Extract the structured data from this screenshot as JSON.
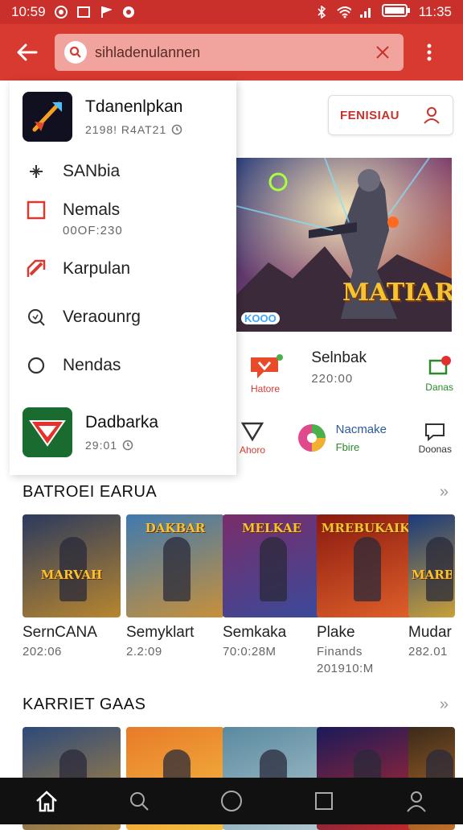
{
  "status_bar": {
    "time_left": "10:59",
    "time_right": "11:35"
  },
  "search": {
    "value": "sihladenulannen",
    "placeholder": ""
  },
  "account": {
    "label": "FENISIAU"
  },
  "drawer": {
    "header": {
      "title": "Tdanenlpkan",
      "subtitle": "2198! R4AT21"
    },
    "items": [
      {
        "label": "SANbia",
        "sub": ""
      },
      {
        "label": "Nemals",
        "sub": "00OF:230"
      },
      {
        "label": "Karpulan",
        "sub": ""
      },
      {
        "label": "Veraounrg",
        "sub": ""
      },
      {
        "label": "Nendas",
        "sub": ""
      }
    ],
    "footer": {
      "title": "Dadbarka",
      "subtitle": "29:01"
    }
  },
  "hero": {
    "title": "MATIARH",
    "tag": "KOOO"
  },
  "news": {
    "title": "Selnbak",
    "sub": "220:00",
    "left_label": "Hatore",
    "right_label": "Danas"
  },
  "row2": {
    "left_label": "Ahoro",
    "center_title": "Nacmake",
    "center_sub": "Fbire",
    "right_label": "Doonas"
  },
  "sections": [
    {
      "title": "BATROEI EARUA",
      "more": "»",
      "games": [
        {
          "name": "SernCANA",
          "sub": "202:06",
          "sub2": "",
          "thumb_text": "MARVAH",
          "colors": [
            "#2b3a5e",
            "#b8862e"
          ]
        },
        {
          "name": "Semyklart",
          "sub": "2.2:09",
          "sub2": "",
          "thumb_text": "DAKBAR",
          "colors": [
            "#3f7ab0",
            "#c8903a"
          ]
        },
        {
          "name": "Semkaka",
          "sub": "70:0:28M",
          "sub2": "",
          "thumb_text": "MELKAE",
          "colors": [
            "#7a2d6a",
            "#3a4a9a"
          ]
        },
        {
          "name": "Plake",
          "sub": "Finands",
          "sub2": "201910:M",
          "thumb_text": "MREBUKAIK",
          "colors": [
            "#8a1a10",
            "#e0602a"
          ]
        },
        {
          "name": "Mudar",
          "sub": "282.01",
          "sub2": "",
          "thumb_text": "MARB",
          "colors": [
            "#1a3a7a",
            "#c9a03a"
          ]
        }
      ]
    },
    {
      "title": "KARRIET GAAS",
      "more": "»",
      "games": [
        {
          "colors": [
            "#2d4a7a",
            "#b88a3a"
          ]
        },
        {
          "colors": [
            "#e87a2a",
            "#f5c040"
          ]
        },
        {
          "colors": [
            "#5a8aa0",
            "#b0c8d0"
          ]
        },
        {
          "colors": [
            "#1a1a5a",
            "#c02a2a"
          ]
        },
        {
          "colors": [
            "#3a2a1a",
            "#c0702a"
          ]
        }
      ]
    }
  ],
  "colors": {
    "brand_red": "#d83a30",
    "status_red": "#c9302c"
  }
}
